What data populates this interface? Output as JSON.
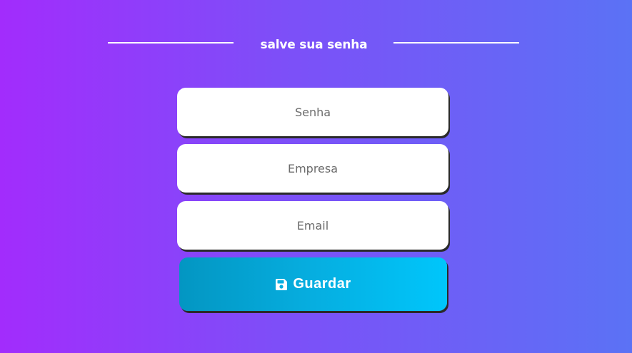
{
  "header": {
    "title": "salve sua senha"
  },
  "form": {
    "password": {
      "placeholder": "Senha",
      "value": ""
    },
    "company": {
      "placeholder": "Empresa",
      "value": ""
    },
    "email": {
      "placeholder": "Email",
      "value": ""
    },
    "save_button": {
      "label": "Guardar",
      "icon": "floppy-disk-icon"
    }
  },
  "colors": {
    "background_start": "#a22cfc",
    "background_end": "#5b72f5",
    "button_start": "#0396c2",
    "button_end": "#00c6fb",
    "text_light": "#ffffff"
  }
}
